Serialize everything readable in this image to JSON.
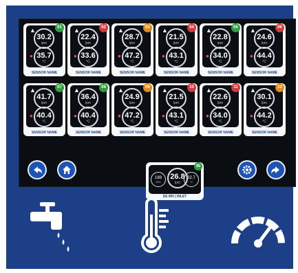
{
  "tiles": [
    {
      "flow": "30.2",
      "temp": "35.7",
      "badge": "01",
      "badge_color": "#2e9e3e"
    },
    {
      "flow": "22.4",
      "temp": "33.6",
      "badge": "02",
      "badge_color": "#d33a3a"
    },
    {
      "flow": "28.7",
      "temp": "47.2",
      "badge": "03",
      "badge_color": "#e08a1e"
    },
    {
      "flow": "21.5",
      "temp": "43.1",
      "badge": "04",
      "badge_color": "#d33a3a"
    },
    {
      "flow": "22.8",
      "temp": "34.0",
      "badge": "05",
      "badge_color": "#2e9e3e"
    },
    {
      "flow": "24.6",
      "temp": "44.4",
      "badge": "06",
      "badge_color": "#d33a3a"
    },
    {
      "flow": "41.7",
      "temp": "40.4",
      "badge": "07",
      "badge_color": "#2e9e3e"
    },
    {
      "flow": "36.4",
      "temp": "40.4",
      "badge": "08",
      "badge_color": "#2e9e3e"
    },
    {
      "flow": "24.9",
      "temp": "47.2",
      "badge": "09",
      "badge_color": "#e08a1e"
    },
    {
      "flow": "21.5",
      "temp": "43.1",
      "badge": "10",
      "badge_color": "#d33a3a"
    },
    {
      "flow": "22.6",
      "temp": "34.0",
      "badge": "11",
      "badge_color": "#d33a3a"
    },
    {
      "flow": "30.1",
      "temp": "44.2",
      "badge": "12",
      "badge_color": "#e08a1e"
    }
  ],
  "units": {
    "flow": "lpm",
    "temp": "°C",
    "pressure": "kPa"
  },
  "sensor_label": "SENSOR NAME",
  "inlet": {
    "pressure": "189",
    "flow": "26.8",
    "temp": "32.7",
    "label": "DE MH | INLET",
    "badge": "IN"
  },
  "nav": {
    "back_icon": "arrow-left-icon",
    "home_icon": "home-icon",
    "settings_icon": "gear-icon",
    "forward_icon": "arrow-right-icon"
  },
  "legend_icons": [
    "faucet-icon",
    "thermometer-icon",
    "gauge-icon"
  ],
  "colors": {
    "frame": "#1c3f88",
    "screen": "#0a0d12",
    "button": "#1d53b5"
  }
}
